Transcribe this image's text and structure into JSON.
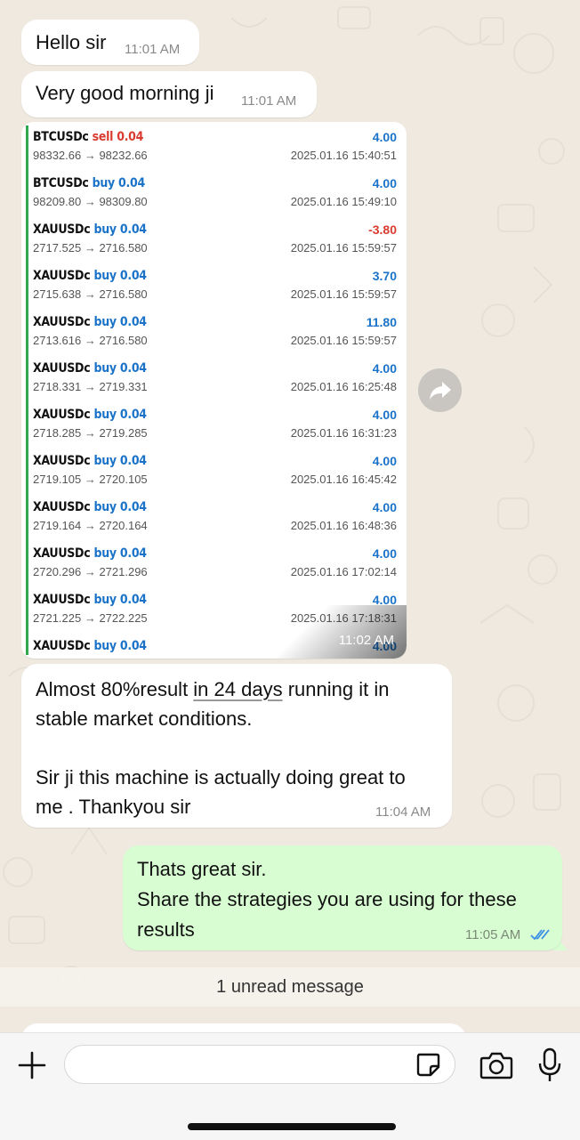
{
  "messages": {
    "m1": {
      "text": "Hello sir",
      "time": "11:01 AM"
    },
    "m2": {
      "text": "Very good morning ji",
      "time": "11:01 AM"
    },
    "image_time": "11:02 AM",
    "m3": {
      "line1_pre": "Almost 80%result ",
      "line1_link": "in 24 days",
      "line1_post": " running it in",
      "line2": "stable market conditions.",
      "line3": "Sir ji this machine is actually doing great to",
      "line4": "me . Thankyou sir",
      "time": "11:04 AM"
    },
    "m4": {
      "line1": "Thats great sir.",
      "line2": "Share the strategies you are using for these",
      "line3": "results",
      "time": "11:05 AM"
    }
  },
  "trades": [
    {
      "symbol": "BTCUSDc",
      "side": "sell",
      "lot": "0.04",
      "prices": "98332.66 → 98232.66",
      "profit": "4.00",
      "time": "2025.01.16 15:40:51"
    },
    {
      "symbol": "BTCUSDc",
      "side": "buy",
      "lot": "0.04",
      "prices": "98209.80 → 98309.80",
      "profit": "4.00",
      "time": "2025.01.16 15:49:10"
    },
    {
      "symbol": "XAUUSDc",
      "side": "buy",
      "lot": "0.04",
      "prices": "2717.525 → 2716.580",
      "profit": "-3.80",
      "time": "2025.01.16 15:59:57"
    },
    {
      "symbol": "XAUUSDc",
      "side": "buy",
      "lot": "0.04",
      "prices": "2715.638 → 2716.580",
      "profit": "3.70",
      "time": "2025.01.16 15:59:57"
    },
    {
      "symbol": "XAUUSDc",
      "side": "buy",
      "lot": "0.04",
      "prices": "2713.616 → 2716.580",
      "profit": "11.80",
      "time": "2025.01.16 15:59:57"
    },
    {
      "symbol": "XAUUSDc",
      "side": "buy",
      "lot": "0.04",
      "prices": "2718.331 → 2719.331",
      "profit": "4.00",
      "time": "2025.01.16 16:25:48"
    },
    {
      "symbol": "XAUUSDc",
      "side": "buy",
      "lot": "0.04",
      "prices": "2718.285 → 2719.285",
      "profit": "4.00",
      "time": "2025.01.16 16:31:23"
    },
    {
      "symbol": "XAUUSDc",
      "side": "buy",
      "lot": "0.04",
      "prices": "2719.105 → 2720.105",
      "profit": "4.00",
      "time": "2025.01.16 16:45:42"
    },
    {
      "symbol": "XAUUSDc",
      "side": "buy",
      "lot": "0.04",
      "prices": "2719.164 → 2720.164",
      "profit": "4.00",
      "time": "2025.01.16 16:48:36"
    },
    {
      "symbol": "XAUUSDc",
      "side": "buy",
      "lot": "0.04",
      "prices": "2720.296 → 2721.296",
      "profit": "4.00",
      "time": "2025.01.16 17:02:14"
    },
    {
      "symbol": "XAUUSDc",
      "side": "buy",
      "lot": "0.04",
      "prices": "2721.225 → 2722.225",
      "profit": "4.00",
      "time": "2025.01.16 17:18:31"
    },
    {
      "symbol": "XAUUSDc",
      "side": "buy",
      "lot": "0.04",
      "prices": "",
      "profit": "4.00",
      "time": ""
    }
  ],
  "unread": {
    "label": "1 unread message"
  },
  "input": {
    "value": "",
    "placeholder": ""
  },
  "icons": {
    "add": "plus-icon",
    "sticker": "sticker-icon",
    "camera": "camera-icon",
    "mic": "microphone-icon",
    "forward": "forward-arrow-icon",
    "read": "double-check-icon"
  },
  "colors": {
    "incoming_bubble": "#ffffff",
    "outgoing_bubble": "#d9fdd3",
    "buy": "#1a73c8",
    "sell": "#d93b2f",
    "read_tick": "#3b8ee6",
    "trade_border": "#2fa84f"
  }
}
